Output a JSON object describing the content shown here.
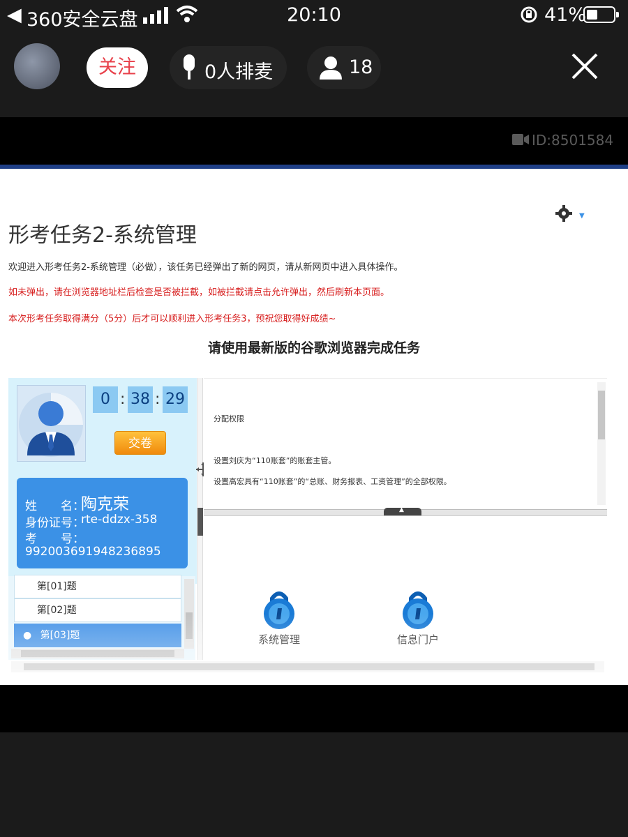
{
  "status_bar": {
    "carrier": "360安全云盘",
    "time": "20:10",
    "battery": "41%"
  },
  "live_bar": {
    "follow_label": "关注",
    "mic_queue": "0人排麦",
    "viewer_count": "18"
  },
  "video": {
    "id_label": "ID:8501584"
  },
  "page": {
    "title": "形考任务2-系统管理",
    "intro": "欢迎进入形考任务2-系统管理（必做），该任务已经弹出了新的网页，请从新网页中进入具体操作。",
    "popup_warning": "如未弹出，请在浏览器地址栏后检查是否被拦截，如被拦截请点击允许弹出，然后刷新本页面。",
    "score_note": "本次形考任务取得满分（5分）后才可以顺利进入形考任务3，预祝您取得好成绩~",
    "browser_note": "请使用最新版的谷歌浏览器完成任务"
  },
  "exam": {
    "timer": {
      "h": "0",
      "m": "38",
      "s": "29"
    },
    "submit_label": "交卷",
    "name_label": "姓　　名：",
    "name_value": "陶克荣",
    "id_label": "身份证号：",
    "id_value": "rte-ddzx-358",
    "exam_no_label": "考　　号：",
    "exam_no_value": "992003691948236895",
    "questions": [
      {
        "label": "第[01]题",
        "selected": false
      },
      {
        "label": "第[02]题",
        "selected": false
      },
      {
        "label": "第[03]题",
        "selected": true
      }
    ]
  },
  "task": {
    "heading": "分配权限",
    "line1": "设置刘庆为“110账套”的账套主管。",
    "line2": "设置高宏具有“110账套”的“总账、财务报表、工资管理”的全部权限。",
    "apps": [
      {
        "label": "系统管理"
      },
      {
        "label": "信息门户"
      }
    ]
  },
  "colors": {
    "accent_blue": "#3b91e6",
    "warning_red": "#d71e1e",
    "submit_orange": "#f5a623"
  }
}
